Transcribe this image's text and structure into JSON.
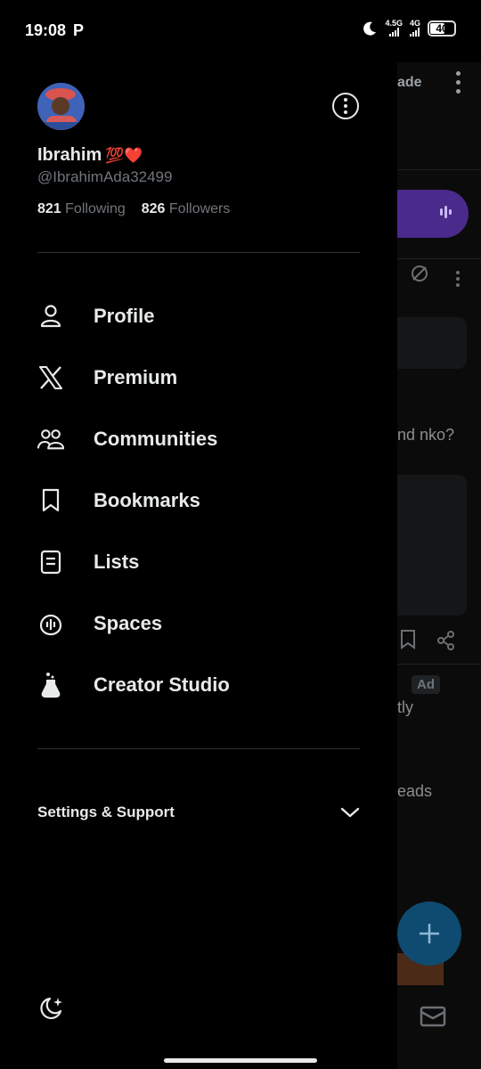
{
  "status_bar": {
    "time": "19:08",
    "carrier_icon": "P",
    "network1": "4.5G",
    "network2": "4G",
    "battery": "40"
  },
  "profile": {
    "display_name": "Ibrahim",
    "name_emoji": "💯❤️",
    "handle": "@IbrahimAda32499",
    "following_count": "821",
    "following_label": "Following",
    "followers_count": "826",
    "followers_label": "Followers"
  },
  "menu": {
    "items": [
      {
        "label": "Profile",
        "icon": "person-icon"
      },
      {
        "label": "Premium",
        "icon": "x-logo-icon"
      },
      {
        "label": "Communities",
        "icon": "communities-icon"
      },
      {
        "label": "Bookmarks",
        "icon": "bookmark-icon"
      },
      {
        "label": "Lists",
        "icon": "list-icon"
      },
      {
        "label": "Spaces",
        "icon": "spaces-icon"
      },
      {
        "label": "Creator Studio",
        "icon": "flask-icon"
      }
    ]
  },
  "settings": {
    "label": "Settings & Support"
  },
  "background": {
    "upgrade_fragment": "ade",
    "text1": "nd nko?",
    "ad_badge": "Ad",
    "text2": "tly",
    "text3": "eads"
  },
  "colors": {
    "background": "#000000",
    "text_primary": "#e7e9ea",
    "text_secondary": "#71767b",
    "divider": "#2f3336"
  }
}
